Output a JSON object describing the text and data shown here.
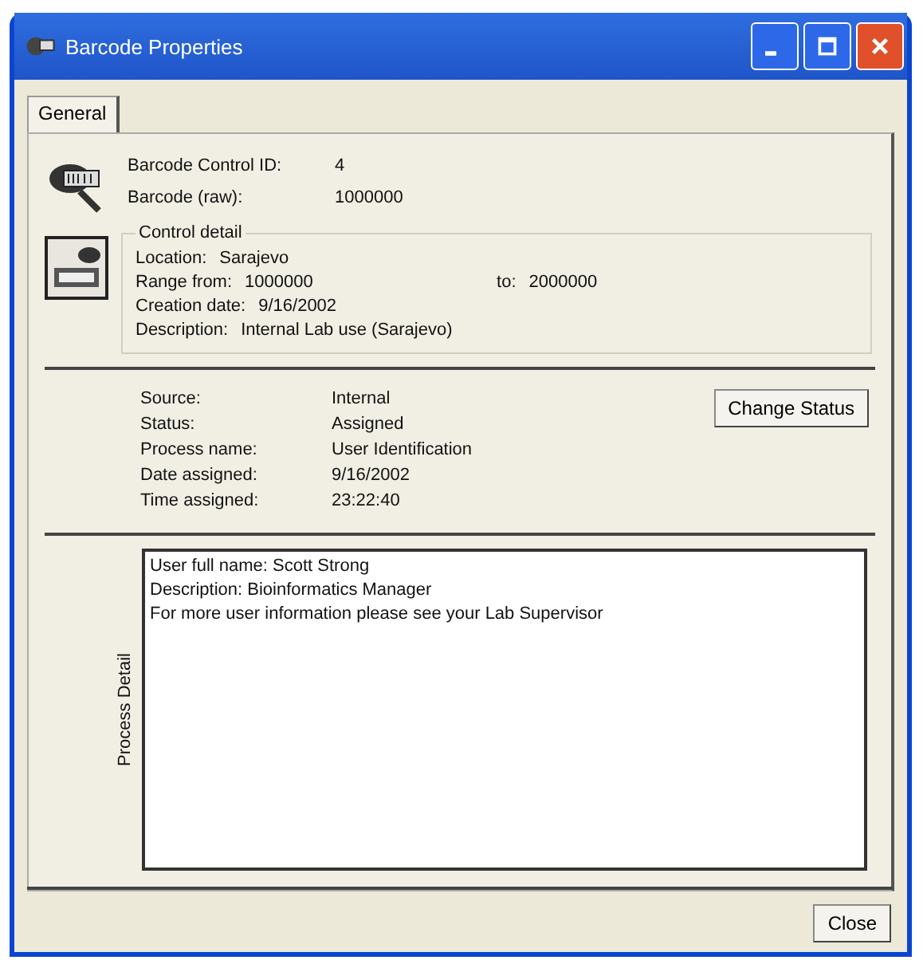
{
  "window": {
    "title": "Barcode Properties"
  },
  "tabs": [
    {
      "label": "General",
      "selected": true
    }
  ],
  "barcode_fields": [
    {
      "label": "Barcode Control ID:",
      "value": "4"
    },
    {
      "label": "Barcode (raw):",
      "value": "1000000"
    }
  ],
  "control_detail": {
    "title": "Control detail",
    "location": {
      "label": "Location:",
      "value": "Sarajevo"
    },
    "range_from": {
      "label": "Range from:",
      "value": "1000000"
    },
    "range_to": {
      "label": "to:",
      "value": "2000000"
    },
    "creation_date": {
      "label": "Creation date:",
      "value": "9/16/2002"
    },
    "description": {
      "label": "Description:",
      "value": "Internal Lab use (Sarajevo)"
    }
  },
  "process_fields": [
    {
      "label": "Source:",
      "value": "Internal"
    },
    {
      "label": "Status:",
      "value": "Assigned"
    },
    {
      "label": "Process name:",
      "value": "User Identification"
    },
    {
      "label": "Date assigned:",
      "value": "9/16/2002"
    },
    {
      "label": "Time assigned:",
      "value": "23:22:40"
    }
  ],
  "change_status_button": "Change Status",
  "process_detail": {
    "label": "Process Detail",
    "lines": [
      "User full name: Scott Strong",
      "Description: Bioinformatics Manager",
      "For more user information please see your Lab Supervisor"
    ]
  },
  "close_button": "Close"
}
